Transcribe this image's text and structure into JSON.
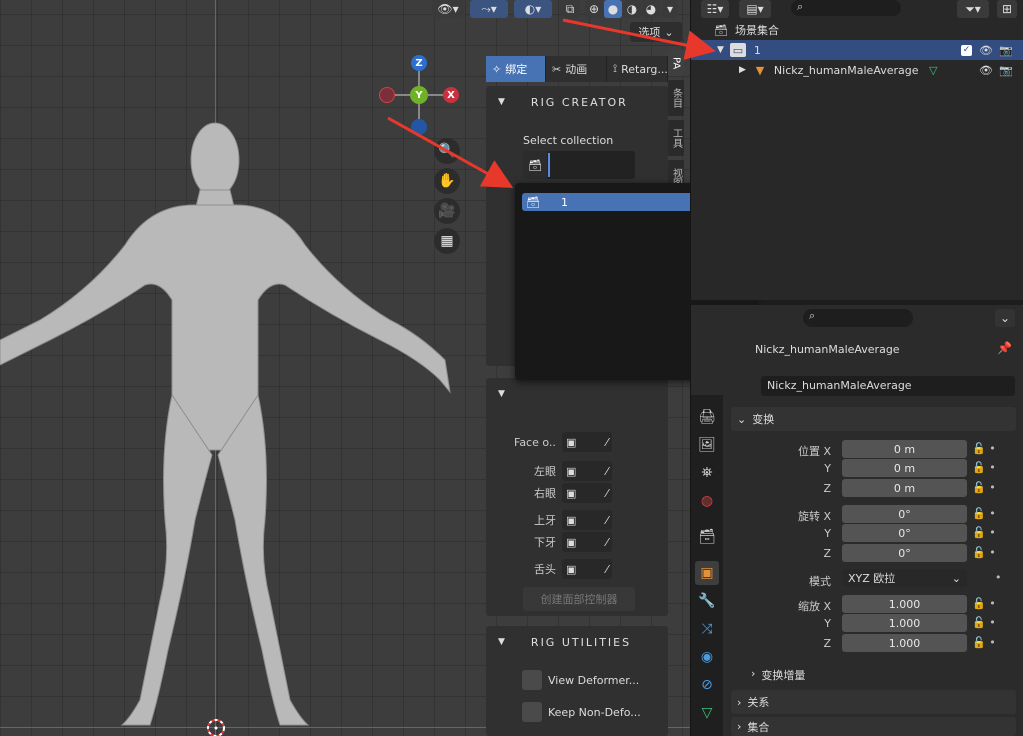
{
  "viewport": {
    "options_label": "选项",
    "gizmo": {
      "z": "Z",
      "y": "Y",
      "x": "X"
    },
    "icons": [
      "eye-icon",
      "cursor-icon",
      "globe-icon",
      "overlay-icon",
      "shading-solid-icon",
      "zoom-icon",
      "hand-icon",
      "camera-icon",
      "grid-icon"
    ]
  },
  "npanel": {
    "tabs": [
      {
        "label": "绑定",
        "icon": "bone-icon"
      },
      {
        "label": "动画",
        "icon": "tools-icon"
      },
      {
        "label": "Retarg...",
        "icon": "retarget-icon"
      }
    ],
    "vtabs": [
      "PA",
      "条目",
      "工具",
      "视图"
    ],
    "rig_creator": {
      "title": "RIG CREATOR",
      "select_collection_label": "Select collection"
    },
    "face_fields": [
      {
        "label": "Face o..."
      },
      {
        "label": "左眼"
      },
      {
        "label": "右眼"
      },
      {
        "label": "上牙"
      },
      {
        "label": "下牙"
      },
      {
        "label": "舌头"
      }
    ],
    "create_face_controls_label": "创建面部控制器",
    "rig_utilities": {
      "title": "RIG UTILITIES",
      "options": [
        "View Deformer...",
        "Keep Non-Defo..."
      ]
    }
  },
  "dropdown": {
    "item_label": "1"
  },
  "outliner": {
    "scene_collection_label": "场景集合",
    "collection_name": "1",
    "object_name": "Nickz_humanMaleAverage"
  },
  "properties": {
    "header_object": "Nickz_humanMaleAverage",
    "name_field": "Nickz_humanMaleAverage",
    "transform_label": "变换",
    "location_label": "位置 X",
    "rotation_label": "旋转 X",
    "scale_label": "缩放 X",
    "y_label": "Y",
    "z_label": "Z",
    "location": [
      "0 m",
      "0 m",
      "0 m"
    ],
    "rotation": [
      "0°",
      "0°",
      "0°"
    ],
    "mode_label": "模式",
    "mode_value": "XYZ 欧拉",
    "scale": [
      "1.000",
      "1.000",
      "1.000"
    ],
    "delta_transform_label": "变换增量",
    "relations_label": "关系",
    "collections_label": "集合"
  },
  "colors": {
    "accent": "#4772b3",
    "arrow": "#e8382c",
    "selected_row": "#334d80"
  }
}
